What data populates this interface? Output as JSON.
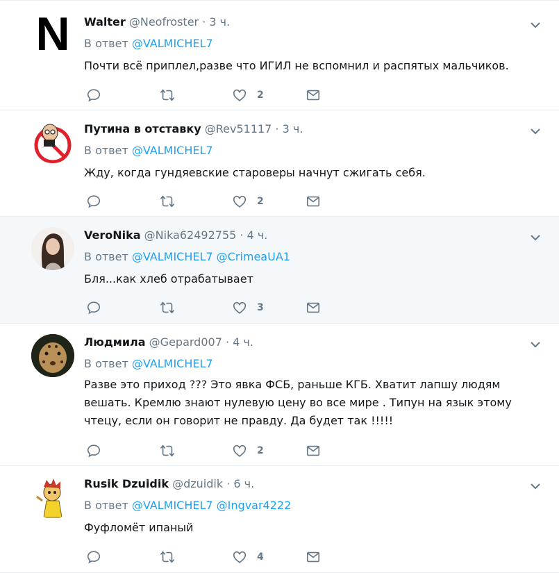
{
  "reply_prefix": "В ответ",
  "tweets": [
    {
      "name": "Walter",
      "handle": "@Neofroster",
      "time": "3 ч.",
      "mentions": [
        "@VALMICHEL7",
        ""
      ],
      "text": "Почти всё приплел,разве что ИГИЛ не вспомнил и распятых мальчиков.",
      "likes": "2",
      "avatar_letter": "N"
    },
    {
      "name": "Путина в отставку",
      "handle": "@Rev51117",
      "time": "3 ч.",
      "mentions": [
        "@VALMICHEL7",
        ""
      ],
      "text": "Жду, когда гундяевские староверы начнут сжигать себя.",
      "likes": "2"
    },
    {
      "name": "VeroNika",
      "handle": "@Nika62492755",
      "time": "4 ч.",
      "mentions": [
        "@VALMICHEL7",
        "@CrimeaUA1"
      ],
      "text": "Бля...как хлеб отрабатывает",
      "likes": "3"
    },
    {
      "name": "Людмила",
      "handle": "@Gepard007",
      "time": "4 ч.",
      "mentions": [
        "@VALMICHEL7",
        ""
      ],
      "text": "Разве это  приход ??? Это явка ФСБ, раньше КГБ. Хватит лапшу людям вешать. Кремлю знают нулевую цену во все мире . Типун на язык этому чтецу, если он говорит не правду. Да будет так !!!!!",
      "likes": "2"
    },
    {
      "name": "Rusik Dzuidik",
      "handle": "@dzuidik",
      "time": "6 ч.",
      "mentions": [
        "@VALMICHEL7",
        "@Ingvar4222"
      ],
      "text": "Фуфломёт ипаный",
      "likes": "4"
    }
  ],
  "colors": {
    "accent": "#1da1f2",
    "muted": "#657786",
    "highlight_bg": "#f5f8fa"
  },
  "icons": [
    "reply-icon",
    "retweet-icon",
    "like-icon",
    "message-icon",
    "chevron-down-icon"
  ]
}
